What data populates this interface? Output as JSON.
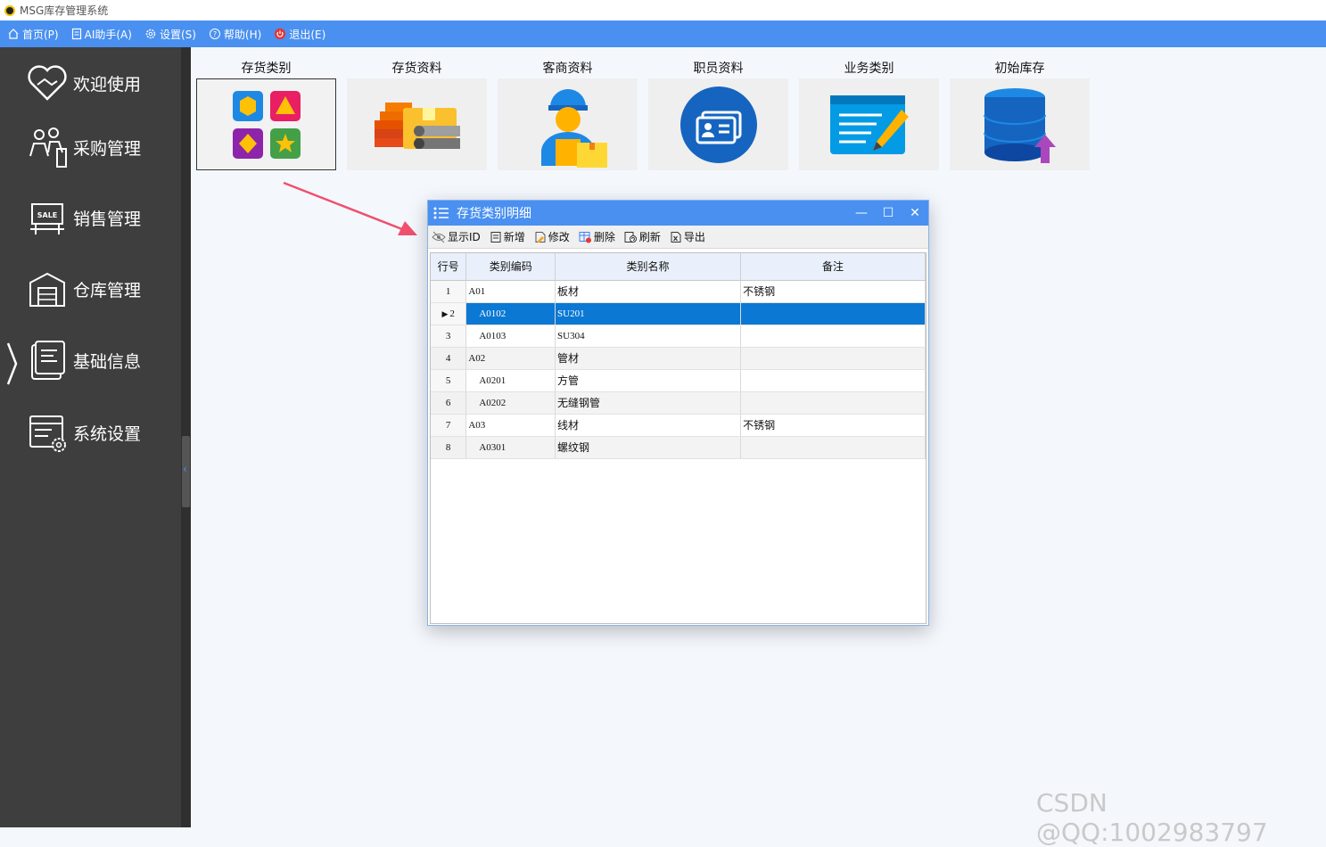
{
  "window": {
    "title": "MSG库存管理系统"
  },
  "menu": [
    {
      "label": "首页(P)",
      "icon": "home-icon"
    },
    {
      "label": "AI助手(A)",
      "icon": "document-icon"
    },
    {
      "label": "设置(S)",
      "icon": "gear-icon"
    },
    {
      "label": "帮助(H)",
      "icon": "help-icon"
    },
    {
      "label": "退出(E)",
      "icon": "power-icon"
    }
  ],
  "sidebar": {
    "items": [
      {
        "label": "欢迎使用",
        "icon": "handshake-heart-icon"
      },
      {
        "label": "采购管理",
        "icon": "purchase-people-icon"
      },
      {
        "label": "销售管理",
        "icon": "sale-sign-icon"
      },
      {
        "label": "仓库管理",
        "icon": "warehouse-icon"
      },
      {
        "label": "基础信息",
        "icon": "info-document-icon"
      },
      {
        "label": "系统设置",
        "icon": "settings-window-icon"
      }
    ],
    "active": "基础信息"
  },
  "tiles": [
    {
      "label": "存货类别",
      "icon": "category-shapes-icon",
      "selected": true
    },
    {
      "label": "存货资料",
      "icon": "goods-materials-icon"
    },
    {
      "label": "客商资料",
      "icon": "customer-worker-icon"
    },
    {
      "label": "职员资料",
      "icon": "employee-card-icon"
    },
    {
      "label": "业务类别",
      "icon": "business-edit-icon"
    },
    {
      "label": "初始库存",
      "icon": "database-upload-icon"
    }
  ],
  "dialog": {
    "title": "存货类别明细",
    "toolbar": [
      "显示ID",
      "新增",
      "修改",
      "删除",
      "刷新",
      "导出"
    ],
    "columns": [
      "行号",
      "类别编码",
      "类别名称",
      "备注"
    ],
    "rows": [
      {
        "no": "1",
        "code": "A01",
        "name": "板材",
        "note": "不锈钢",
        "indent": 0
      },
      {
        "no": "2",
        "code": "A0102",
        "name": "SU201",
        "note": "",
        "indent": 1,
        "selected": true
      },
      {
        "no": "3",
        "code": "A0103",
        "name": "SU304",
        "note": "",
        "indent": 1
      },
      {
        "no": "4",
        "code": "A02",
        "name": "管材",
        "note": "",
        "indent": 0
      },
      {
        "no": "5",
        "code": "A0201",
        "name": "方管",
        "note": "",
        "indent": 1
      },
      {
        "no": "6",
        "code": "A0202",
        "name": "无缝钢管",
        "note": "",
        "indent": 1
      },
      {
        "no": "7",
        "code": "A03",
        "name": "线材",
        "note": "不锈钢",
        "indent": 0
      },
      {
        "no": "8",
        "code": "A0301",
        "name": "螺纹钢",
        "note": "",
        "indent": 1
      }
    ]
  },
  "watermark": "CSDN @QQ:1002983797",
  "colors": {
    "accent": "#4a90f0",
    "sidebar": "#3e3e3e",
    "selection": "#0b78d4",
    "arrow": "#f0506e"
  }
}
